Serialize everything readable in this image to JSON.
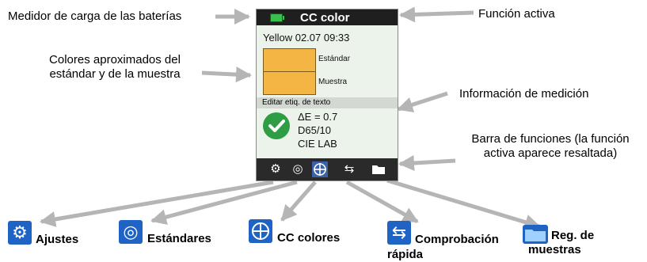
{
  "callouts": {
    "battery": "Medidor de carga de las baterías",
    "active_function": "Función activa",
    "colors_line1": "Colores aproximados del",
    "colors_line2": "estándar y de la muestra",
    "measurement_info": "Información de medición",
    "toolbar_line1": "Barra de funciones (la función",
    "toolbar_line2": "activa aparece resaltada)"
  },
  "screen": {
    "title": "CC color",
    "sample": "Yellow 02.07 09:33",
    "standard_label": "Estándar",
    "sample_label": "Muestra",
    "edit_label": "Editar etiq. de texto",
    "delta_e": "ΔE = 0.7",
    "illuminant": "D65/10",
    "color_space": "CIE LAB",
    "swatch_color": "#f4b544",
    "pass_icon": "check-icon",
    "toolbar_icons": [
      "gear-icon",
      "target-icon",
      "crosshair-icon",
      "arrows-icon",
      "folder-icon"
    ],
    "active_toolbar_icon": "crosshair-icon"
  },
  "legend": {
    "settings": "Ajustes",
    "standards": "Estándares",
    "color_qc": "CC colores",
    "quick_check_1": "Comprobación",
    "quick_check_2": "rápida",
    "records_1": "Reg. de",
    "records_2": "muestras",
    "icon_color": "#1f64c4"
  }
}
